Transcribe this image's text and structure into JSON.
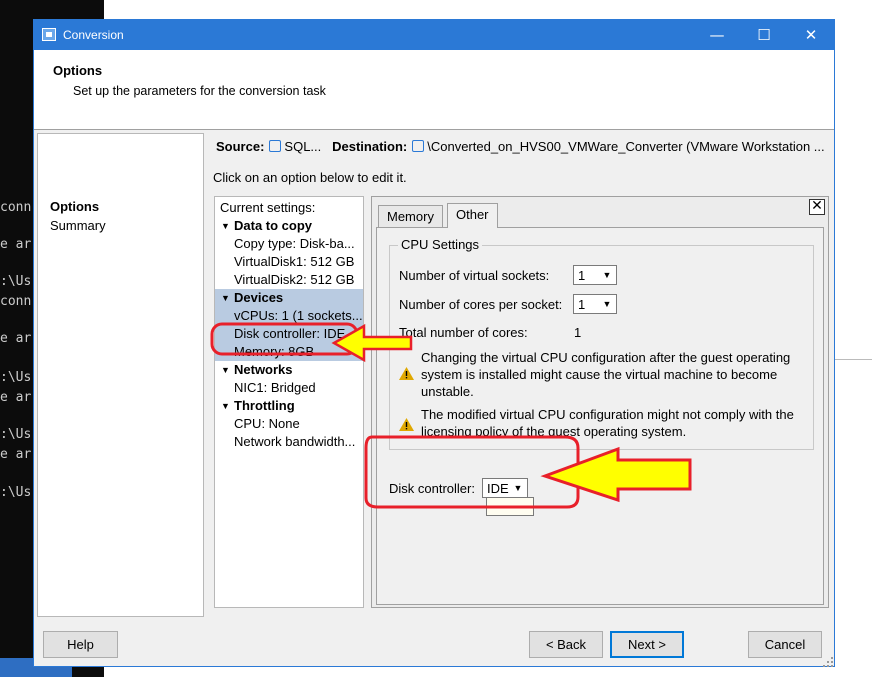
{
  "terminal": {
    "lines": [
      "conn",
      "e ar",
      ":\\Us",
      "conn",
      "e ar",
      ":\\Us",
      "e ar",
      ":\\Us",
      "e ar",
      ":\\Us"
    ]
  },
  "window": {
    "title": "Conversion",
    "minimize": "—",
    "maximize": "☐",
    "close": "✕"
  },
  "header": {
    "title": "Options",
    "subtitle": "Set up the parameters for the conversion task"
  },
  "nav": {
    "items": [
      "Options",
      "Summary"
    ]
  },
  "source": {
    "source_label": "Source:",
    "source_value": "SQL...",
    "destination_label": "Destination:",
    "destination_value": "\\Converted_on_HVS00_VMWare_Converter (VMware Workstation ..."
  },
  "hint": "Click on an option below to edit it.",
  "tree": {
    "heading": "Current settings:",
    "data_to_copy": "Data to copy",
    "copy_type": "Copy type: Disk-ba...",
    "vdisk1": "VirtualDisk1: 512 GB",
    "vdisk2": "VirtualDisk2: 512 GB",
    "devices": "Devices",
    "vcpus": "vCPUs: 1 (1 sockets...",
    "disk_controller": "Disk controller: IDE",
    "memory": "Memory: 8GB",
    "networks": "Networks",
    "nic1": "NIC1: Bridged",
    "throttling": "Throttling",
    "cpu": "CPU: None",
    "bandwidth": "Network bandwidth..."
  },
  "tabs": {
    "memory": "Memory",
    "other": "Other",
    "active": "Other"
  },
  "cpu": {
    "legend": "CPU Settings",
    "sockets_label": "Number of virtual sockets:",
    "sockets_value": "1",
    "cores_label": "Number of cores per socket:",
    "cores_value": "1",
    "total_label": "Total number of cores:",
    "total_value": "1",
    "warning1": "Changing the virtual CPU configuration after the guest operating system is installed might cause the virtual machine to become unstable.",
    "warning2": "The modified virtual CPU configuration might not comply with the licensing policy of the guest operating system."
  },
  "disk_controller": {
    "label": "Disk controller:",
    "value": "IDE"
  },
  "buttons": {
    "help": "Help",
    "back": "< Back",
    "next": "Next >",
    "cancel": "Cancel"
  },
  "colors": {
    "titlebar": "#2b79d6",
    "selection": "#b9cbe1",
    "annotation_red": "#e8202a",
    "annotation_yellow": "#ffff00"
  }
}
